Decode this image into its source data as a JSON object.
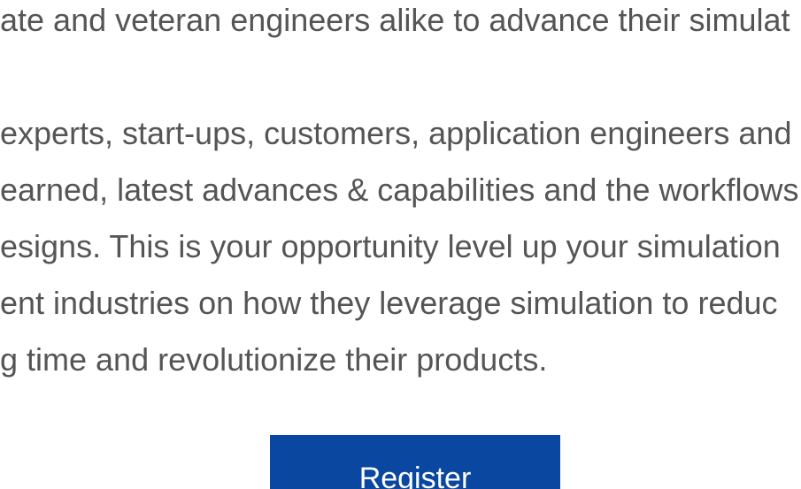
{
  "body": {
    "paragraph1": [
      "ate and veteran engineers alike to advance their simulat"
    ],
    "paragraph2": [
      "experts, start-ups, customers, application engineers and",
      "earned, latest advances & capabilities and the workflows",
      "esigns. This is your opportunity level up your simulation",
      "ent industries on how they leverage simulation to reduc",
      "g time and revolutionize their products."
    ]
  },
  "cta": {
    "register_label": "Register"
  },
  "colors": {
    "text": "#555555",
    "button_bg": "#0a47a0",
    "button_text": "#ffffff"
  }
}
